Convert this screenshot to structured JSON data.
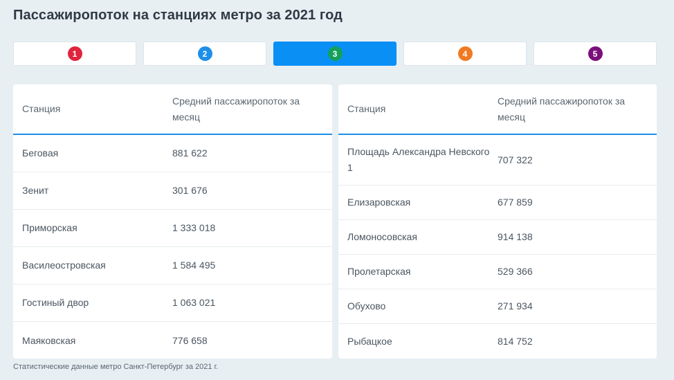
{
  "title": "Пассажиропоток на станциях метро за 2021 год",
  "tabs": [
    {
      "label": "1",
      "color": "#e0243d",
      "active": false
    },
    {
      "label": "2",
      "color": "#1e8fe8",
      "active": false
    },
    {
      "label": "3",
      "color": "#14a05a",
      "active": true
    },
    {
      "label": "4",
      "color": "#f07a22",
      "active": false
    },
    {
      "label": "5",
      "color": "#7b0f7a",
      "active": false
    }
  ],
  "table_left": {
    "headers": [
      "Станция",
      "Средний пассажиропоток за месяц"
    ],
    "rows": [
      [
        "Беговая",
        "881 622"
      ],
      [
        "Зенит",
        "301 676"
      ],
      [
        "Приморская",
        "1 333 018"
      ],
      [
        "Василеостровская",
        "1 584 495"
      ],
      [
        "Гостиный двор",
        "1 063 021"
      ],
      [
        "Маяковская",
        "776 658"
      ]
    ]
  },
  "table_right": {
    "headers": [
      "Станция",
      "Средний пассажиропоток за месяц"
    ],
    "rows": [
      [
        "Площадь Александра Невского 1",
        "707 322"
      ],
      [
        "Елизаровская",
        "677 859"
      ],
      [
        "Ломоносовская",
        "914 138"
      ],
      [
        "Пролетарская",
        "529 366"
      ],
      [
        "Обухово",
        "271 934"
      ],
      [
        "Рыбацкое",
        "814 752"
      ]
    ]
  },
  "footnote": "Статистические данные метро Санкт-Петербург за 2021 г.",
  "colors": {
    "accent": "#0a8ff5",
    "header_rule": "#1e8fe8"
  }
}
